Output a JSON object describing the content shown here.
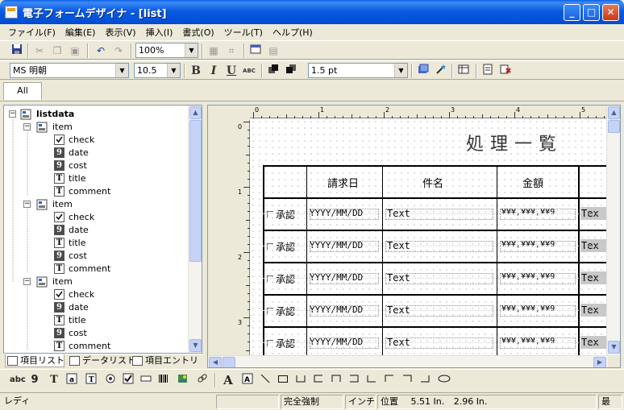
{
  "window": {
    "title": "電子フォームデザイナ - [list]",
    "minimize": "_",
    "maximize": "□",
    "close": "✕"
  },
  "menu": [
    "ファイル(F)",
    "編集(E)",
    "表示(V)",
    "挿入(I)",
    "書式(O)",
    "ツール(T)",
    "ヘルプ(H)"
  ],
  "toolbar": {
    "zoom": "100%",
    "font_name": "MS 明朝",
    "font_size": "10.5",
    "bold": "B",
    "italic": "I",
    "underline": "U",
    "strike": "ABC",
    "line_width": "1.5 pt"
  },
  "tabs": {
    "all": "All"
  },
  "tree": {
    "root": "listdata",
    "items": [
      {
        "label": "item",
        "children": [
          {
            "label": "check",
            "icon": "checkbox-icon"
          },
          {
            "label": "date",
            "icon": "9"
          },
          {
            "label": "cost",
            "icon": "9"
          },
          {
            "label": "title",
            "icon": "T"
          },
          {
            "label": "comment",
            "icon": "T"
          }
        ]
      },
      {
        "label": "item",
        "children": [
          {
            "label": "check",
            "icon": "checkbox-icon"
          },
          {
            "label": "date",
            "icon": "9"
          },
          {
            "label": "title",
            "icon": "T"
          },
          {
            "label": "cost",
            "icon": "9"
          },
          {
            "label": "comment",
            "icon": "T"
          }
        ]
      },
      {
        "label": "item",
        "children": [
          {
            "label": "check",
            "icon": "checkbox-icon"
          },
          {
            "label": "date",
            "icon": "9"
          },
          {
            "label": "title",
            "icon": "T"
          },
          {
            "label": "cost",
            "icon": "9"
          },
          {
            "label": "comment",
            "icon": "T"
          }
        ]
      }
    ]
  },
  "left_tabs": {
    "items_list": "項目リスト",
    "data_list": "データリスト",
    "item_entry": "項目エントリ"
  },
  "ruler": {
    "h_numbers": [
      "0",
      "1",
      "2",
      "3",
      "4",
      "5"
    ],
    "v_numbers": [
      "0",
      "1",
      "2",
      "3"
    ]
  },
  "form": {
    "title": "処理一覧",
    "headers": [
      "請求日",
      "件名",
      "金額"
    ],
    "rows": [
      {
        "check": "承認",
        "date": "YYYY/MM/DD",
        "subject": "Text",
        "amount": "¥¥¥,¥¥¥,¥¥9",
        "extra": "Tex"
      },
      {
        "check": "承認",
        "date": "YYYY/MM/DD",
        "subject": "Text",
        "amount": "¥¥¥,¥¥¥,¥¥9",
        "extra": "Tex"
      },
      {
        "check": "承認",
        "date": "YYYY/MM/DD",
        "subject": "Text",
        "amount": "¥¥¥,¥¥¥,¥¥9",
        "extra": "Tex"
      },
      {
        "check": "承認",
        "date": "YYYY/MM/DD",
        "subject": "Text",
        "amount": "¥¥¥,¥¥¥,¥¥9",
        "extra": "Tex"
      },
      {
        "check": "承認",
        "date": "YYYY/MM/DD",
        "subject": "Text",
        "amount": "¥¥¥,¥¥¥,¥¥9",
        "extra": "Tex"
      }
    ]
  },
  "drawtools": {
    "abc": "abc",
    "nine": "9",
    "text": "T",
    "big_a": "A"
  },
  "status": {
    "ready": "レディ",
    "mode": "完全強制",
    "unit": "インチ",
    "pos_label": "位置",
    "x": "5.51 In.",
    "y": "2.96 In.",
    "last": "最"
  }
}
